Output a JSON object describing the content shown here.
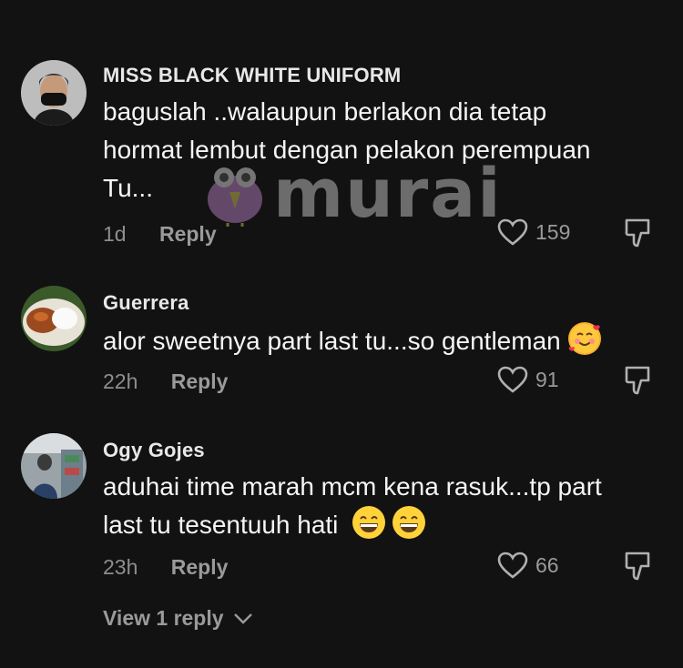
{
  "comments": [
    {
      "username": "MISS BLACK WHITE UNIFORM",
      "text_lines": [
        "baguslah ..walaupun berlakon dia tetap",
        "hormat lembut dengan pelakon perempuan",
        "Tu..."
      ],
      "time": "1d",
      "reply_label": "Reply",
      "likes": "159"
    },
    {
      "username": "Guerrera",
      "text": "alor sweetnya part last tu...so gentleman",
      "time": "22h",
      "reply_label": "Reply",
      "likes": "91",
      "emoji_icons": [
        "smiling-face-with-hearts-icon"
      ]
    },
    {
      "username": "Ogy Gojes",
      "text_lines": [
        "aduhai time marah mcm kena rasuk...tp part",
        "last tu tesentuuh hati"
      ],
      "time": "23h",
      "reply_label": "Reply",
      "likes": "66",
      "emoji_icons": [
        "grinning-face-icon",
        "grinning-face-icon"
      ]
    }
  ],
  "view_replies_label": "View 1 reply",
  "watermark": "murai",
  "colors": {
    "background": "#121212",
    "primary_text": "#f5f5f5",
    "secondary_text": "#8e8e8e"
  }
}
